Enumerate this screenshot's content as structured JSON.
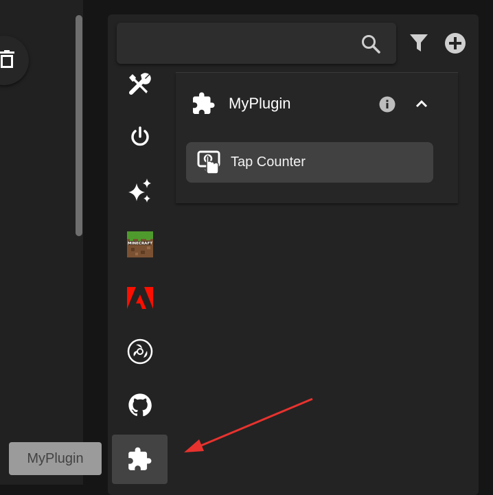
{
  "search": {
    "placeholder": "",
    "value": ""
  },
  "plugin": {
    "name": "MyPlugin",
    "actions": [
      {
        "label": "Tap Counter",
        "icon": "tap-screen-icon"
      }
    ]
  },
  "sidebar": {
    "items": [
      {
        "id": "tools",
        "icon": "tools-icon"
      },
      {
        "id": "power",
        "icon": "power-icon"
      },
      {
        "id": "sparkle",
        "icon": "sparkle-icon"
      },
      {
        "id": "minecraft",
        "icon": "minecraft-logo-icon"
      },
      {
        "id": "adobe",
        "icon": "adobe-logo-icon"
      },
      {
        "id": "obs",
        "icon": "obs-logo-icon"
      },
      {
        "id": "github",
        "icon": "github-logo-icon"
      },
      {
        "id": "plugin",
        "icon": "puzzle-icon",
        "selected": true
      }
    ]
  },
  "tooltip": {
    "text": "MyPlugin"
  },
  "colors": {
    "background": "#151515",
    "panel": "#232323",
    "selected": "#434343",
    "annotation_arrow": "#e8322e"
  }
}
